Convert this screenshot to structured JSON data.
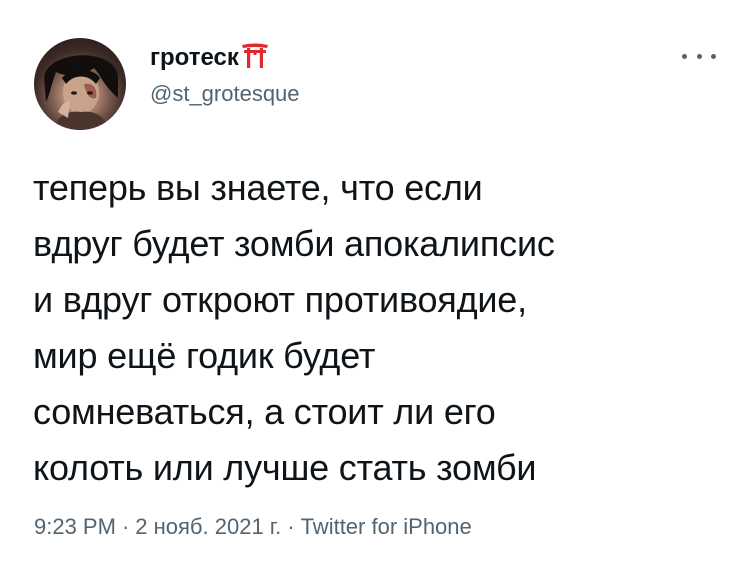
{
  "author": {
    "display_name": "гротеск",
    "handle": "@st_grotesque",
    "emoji_icon": "torii-gate-icon"
  },
  "tweet": {
    "text_lines": [
      "теперь вы знаете, что если",
      "вдруг будет зомби апокалипсис",
      "и вдруг откроют противоядие,",
      "мир ещё годик будет",
      "сомневаться, а стоит ли его",
      "колоть или лучше стать зомби"
    ]
  },
  "meta": {
    "time": "9:23 PM",
    "date": "2 нояб. 2021 г.",
    "separator": "·",
    "source": "Twitter for iPhone"
  },
  "colors": {
    "text_primary": "#0f1419",
    "text_secondary": "#536471",
    "torii": "#e0292e"
  },
  "icons": {
    "more": "more-horizontal-icon",
    "avatar": "user-avatar-image"
  }
}
